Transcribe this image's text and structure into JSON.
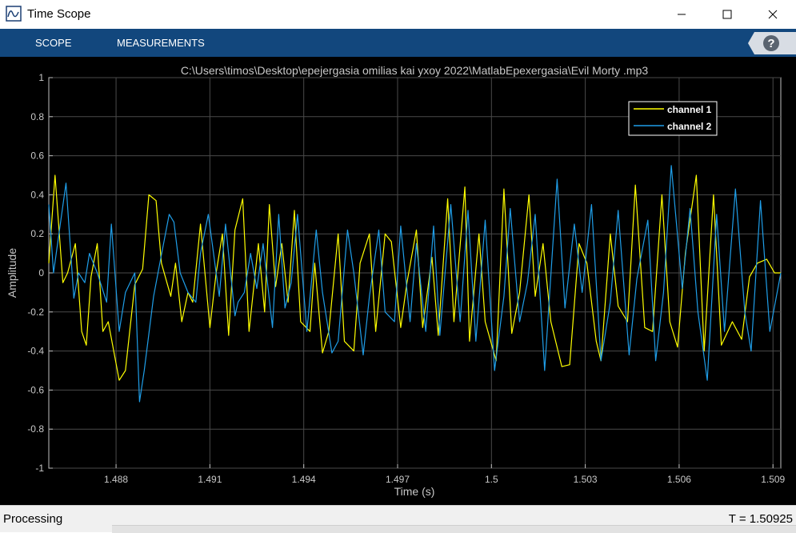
{
  "window": {
    "title": "Time Scope",
    "icon": "time-scope-icon"
  },
  "toolstrip": {
    "tabs": [
      {
        "label": "SCOPE"
      },
      {
        "label": "MEASUREMENTS"
      }
    ],
    "help_icon": "help-icon"
  },
  "status": {
    "text": "Processing",
    "time_readout": "T = 1.50925"
  },
  "colors": {
    "toolstrip": "#12477d",
    "channel1": "#ffff00",
    "channel2": "#1f9ee8",
    "plot_bg": "#000000"
  },
  "chart_data": {
    "type": "line",
    "title": "C:\\Users\\timos\\Desktop\\epejergasia omilias kai yxoy 2022\\MatlabEpexergasia\\Evil Morty .mp3",
    "xlabel": "Time (s)",
    "ylabel": "Amplitude",
    "xlim": [
      1.48585,
      1.50925
    ],
    "ylim": [
      -1,
      1
    ],
    "xticks": [
      1.488,
      1.491,
      1.494,
      1.497,
      1.5,
      1.503,
      1.506,
      1.509
    ],
    "xtick_labels": [
      "1.488",
      "1.491",
      "1.494",
      "1.497",
      "1.5",
      "1.503",
      "1.506",
      "1.509"
    ],
    "yticks": [
      1,
      0.8,
      0.6,
      0.4,
      0.2,
      0,
      -0.2,
      -0.4,
      -0.6,
      -0.8,
      -1
    ],
    "ytick_labels": [
      "1",
      "0.8",
      "0.6",
      "0.4",
      "0.2",
      "0",
      "-0.2",
      "-0.4",
      "-0.6",
      "-0.8",
      "-1"
    ],
    "grid": true,
    "legend_position": "top-right",
    "series": [
      {
        "name": "channel 1",
        "color": "#ffff00",
        "x": [
          1.48585,
          1.48605,
          1.4863,
          1.48645,
          1.4867,
          1.4869,
          1.48705,
          1.4872,
          1.4874,
          1.48758,
          1.48775,
          1.4881,
          1.4883,
          1.4886,
          1.48885,
          1.48905,
          1.48928,
          1.48945,
          1.48975,
          1.4899,
          1.4901,
          1.4903,
          1.49045,
          1.4907,
          1.491,
          1.4912,
          1.4914,
          1.4916,
          1.4918,
          1.49205,
          1.49225,
          1.49255,
          1.49275,
          1.4929,
          1.4931,
          1.4933,
          1.4935,
          1.4937,
          1.4939,
          1.4942,
          1.49435,
          1.4946,
          1.4948,
          1.4951,
          1.4953,
          1.4956,
          1.4958,
          1.4961,
          1.4963,
          1.4966,
          1.4968,
          1.4971,
          1.4973,
          1.4976,
          1.4978,
          1.4981,
          1.4983,
          1.4986,
          1.4988,
          1.49915,
          1.4993,
          1.4996,
          1.4998,
          1.50015,
          1.5004,
          1.50065,
          1.5009,
          1.5012,
          1.5014,
          1.50165,
          1.5019,
          1.50225,
          1.5025,
          1.5028,
          1.50305,
          1.50335,
          1.5035,
          1.5038,
          1.50405,
          1.50435,
          1.5046,
          1.5049,
          1.50515,
          1.50545,
          1.5057,
          1.50595,
          1.5062,
          1.50655,
          1.5068,
          1.5071,
          1.50735,
          1.5077,
          1.508,
          1.50825,
          1.5085,
          1.5088,
          1.50905,
          1.50925
        ],
        "y": [
          0.05,
          0.5,
          -0.05,
          0.0,
          0.15,
          -0.3,
          -0.37,
          -0.02,
          0.15,
          -0.3,
          -0.25,
          -0.55,
          -0.5,
          -0.06,
          0.02,
          0.4,
          0.37,
          0.05,
          -0.12,
          0.05,
          -0.25,
          -0.1,
          -0.15,
          0.25,
          -0.28,
          0.0,
          0.2,
          -0.32,
          0.22,
          0.38,
          -0.3,
          0.15,
          -0.2,
          0.35,
          -0.07,
          0.15,
          -0.15,
          0.32,
          -0.25,
          -0.3,
          0.05,
          -0.41,
          -0.3,
          0.2,
          -0.35,
          -0.4,
          0.05,
          0.2,
          -0.3,
          0.2,
          0.16,
          -0.28,
          -0.05,
          0.22,
          -0.28,
          0.08,
          -0.32,
          0.38,
          -0.25,
          0.44,
          -0.35,
          0.2,
          -0.25,
          -0.45,
          0.43,
          -0.31,
          -0.1,
          0.4,
          -0.12,
          0.15,
          -0.25,
          -0.48,
          -0.47,
          0.15,
          0.05,
          -0.35,
          -0.45,
          0.2,
          -0.17,
          -0.25,
          0.45,
          -0.28,
          -0.3,
          0.4,
          -0.25,
          -0.38,
          0.1,
          0.5,
          -0.4,
          0.4,
          -0.37,
          -0.25,
          -0.34,
          -0.02,
          0.05,
          0.07,
          0.0,
          0.0
        ]
      },
      {
        "name": "channel 2",
        "color": "#1f9ee8",
        "x": [
          1.48585,
          1.486,
          1.4864,
          1.48665,
          1.4868,
          1.487,
          1.48715,
          1.4874,
          1.4877,
          1.48785,
          1.4881,
          1.4883,
          1.4886,
          1.48875,
          1.4889,
          1.4892,
          1.4894,
          1.4897,
          1.48985,
          1.49005,
          1.4903,
          1.49055,
          1.4907,
          1.49095,
          1.4913,
          1.4915,
          1.4918,
          1.4919,
          1.4921,
          1.4923,
          1.4925,
          1.4927,
          1.493,
          1.4932,
          1.4934,
          1.4936,
          1.4938,
          1.4941,
          1.4944,
          1.4946,
          1.4949,
          1.4951,
          1.4954,
          1.4956,
          1.4959,
          1.4961,
          1.4964,
          1.4966,
          1.4969,
          1.4971,
          1.4974,
          1.4976,
          1.4979,
          1.49815,
          1.49835,
          1.4987,
          1.499,
          1.49925,
          1.4995,
          1.4998,
          1.5001,
          1.5004,
          1.5006,
          1.5009,
          1.50115,
          1.5014,
          1.5017,
          1.5021,
          1.50235,
          1.50265,
          1.5029,
          1.5032,
          1.5035,
          1.5038,
          1.50405,
          1.5044,
          1.50465,
          1.505,
          1.50525,
          1.5055,
          1.50575,
          1.5061,
          1.50635,
          1.5066,
          1.5069,
          1.5072,
          1.50745,
          1.5078,
          1.5081,
          1.5083,
          1.5086,
          1.5089,
          1.50925
        ],
        "y": [
          0.35,
          0.0,
          0.46,
          -0.13,
          0.0,
          -0.05,
          0.1,
          0.0,
          -0.15,
          0.25,
          -0.3,
          -0.1,
          0.0,
          -0.66,
          -0.5,
          -0.12,
          0.05,
          0.3,
          0.26,
          0.0,
          -0.1,
          -0.15,
          0.1,
          0.3,
          -0.12,
          0.25,
          -0.22,
          -0.15,
          -0.1,
          0.1,
          -0.08,
          0.15,
          -0.28,
          0.3,
          -0.18,
          -0.05,
          0.3,
          -0.3,
          0.22,
          -0.1,
          -0.41,
          -0.35,
          0.22,
          0.0,
          -0.42,
          -0.12,
          0.22,
          -0.2,
          -0.25,
          0.24,
          -0.25,
          0.15,
          -0.3,
          0.24,
          -0.32,
          0.35,
          -0.25,
          0.32,
          -0.35,
          0.27,
          -0.5,
          -0.12,
          0.33,
          -0.25,
          -0.05,
          0.3,
          -0.5,
          0.48,
          -0.18,
          0.25,
          -0.1,
          0.35,
          -0.45,
          -0.15,
          0.32,
          -0.42,
          -0.03,
          0.27,
          -0.45,
          -0.1,
          0.55,
          -0.08,
          0.33,
          -0.2,
          -0.55,
          0.3,
          -0.3,
          0.43,
          -0.2,
          -0.4,
          0.37,
          -0.3,
          0.0
        ]
      }
    ]
  }
}
